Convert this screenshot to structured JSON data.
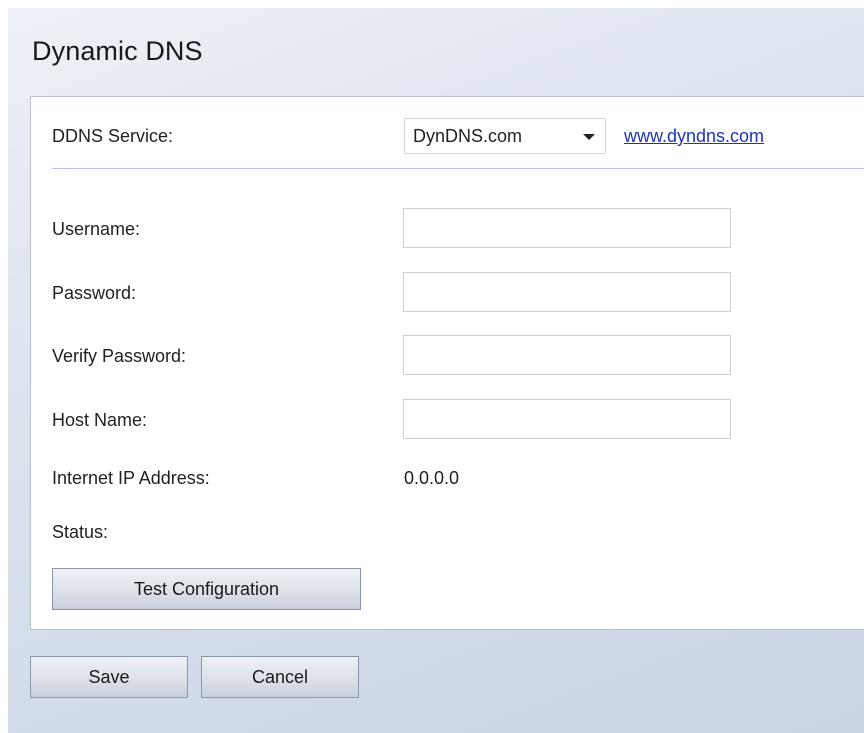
{
  "page": {
    "title": "Dynamic DNS"
  },
  "ddns": {
    "service_label": "DDNS Service:",
    "service_value": "DynDNS.com",
    "service_link": "www.dyndns.com"
  },
  "form": {
    "username_label": "Username:",
    "username_value": "",
    "password_label": "Password:",
    "password_value": "",
    "verify_label": "Verify Password:",
    "verify_value": "",
    "host_label": "Host Name:",
    "host_value": "",
    "ip_label": "Internet IP Address:",
    "ip_value": "0.0.0.0",
    "status_label": "Status:",
    "status_value": ""
  },
  "buttons": {
    "test": "Test Configuration",
    "save": "Save",
    "cancel": "Cancel"
  },
  "colors": {
    "link": "#1a35b8",
    "separator": "#b8c0e8",
    "background": "#dde4ef"
  }
}
